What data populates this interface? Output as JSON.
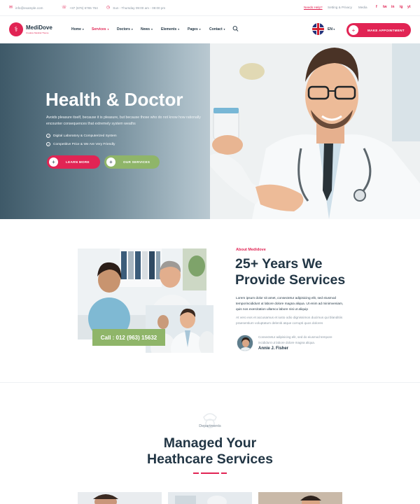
{
  "topbar": {
    "email": "info@example.com",
    "phone": "+87 (676) 6765 764",
    "hours": "Sun - Thursday 09:00 am - 08:00 pm",
    "needs_help": "Needs Help?",
    "setting_privacy": "Setting & Privacy",
    "media": "Media",
    "social": [
      "f",
      "tw",
      "in",
      "ig",
      "yt"
    ]
  },
  "header": {
    "logo_name": "MediDove",
    "logo_tagline": "Creative Medical Theme",
    "nav": [
      "Home",
      "Services",
      "Doctors",
      "News",
      "Elements",
      "Pages",
      "Contact"
    ],
    "active_nav": "Services",
    "language": "EN",
    "appointment_button": "MAKE APPOINTMENT"
  },
  "hero": {
    "title": "Health & Doctor",
    "description": "Avoids pleasure itself, because it is pleasure, but because those who do not know how rationally encounter consequences that extremely system weaths",
    "bullets": [
      "Digital Laboratory & Computerized System",
      "Competitive Price & We Are Very Friendly"
    ],
    "learn_more": "LEARN MORE",
    "our_services": "OUR SERVICES"
  },
  "about": {
    "eyebrow": "About Medidove",
    "title_line1": "25+ Years We",
    "title_line2": "Provide Services",
    "text1": "Lorem ipsum dolor sit amet, consectetur adipisicing elit, sed eiusmod temporincididunt ut labore dolore magna aliqua. Ut enim ad minimveniam, quis nos exercitation ullamco labore nisi ut aliquip",
    "text2": "At vero eos et accusamus et iusto odio dignissimos ducimus qui blanditiis praesentium voluptatum deleniti atque corrupti quos dolores",
    "call": "Call : 012 (963) 15632",
    "quote": "Consectetur adipisicing elit, sed do eiusmod tempore incididunt ut labore dolore magna aliqua.",
    "person": "Annie J. Fisher"
  },
  "departments": {
    "eyebrow": "Departments",
    "title_line1": "Managed Your",
    "title_line2": "Heathcare Services"
  },
  "colors": {
    "accent": "#e12454",
    "green": "#8fb569",
    "heading": "#223645",
    "muted": "#8a97a3"
  }
}
